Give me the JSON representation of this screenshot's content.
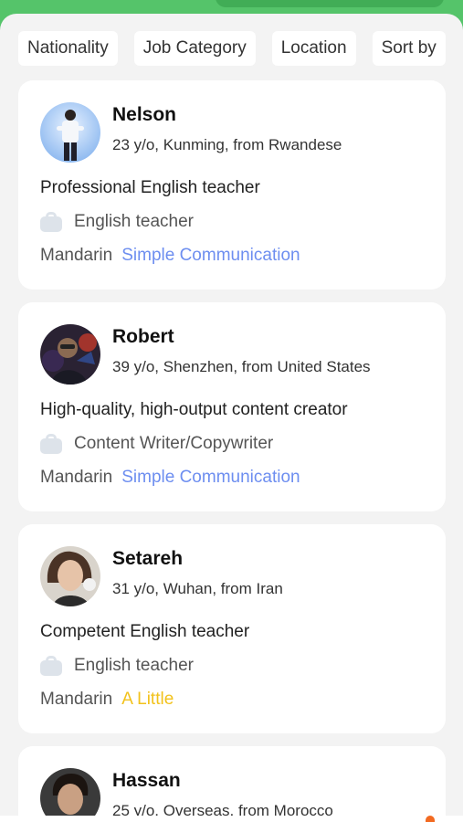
{
  "filters": [
    "Nationality",
    "Job Category",
    "Location",
    "Sort by"
  ],
  "candidates": [
    {
      "name": "Nelson",
      "meta": "23 y/o, Kunming, from Rwandese",
      "headline": "Professional English teacher",
      "job": "English teacher",
      "language": "Mandarin",
      "level": "Simple Communication",
      "level_color": "#6d8ef0"
    },
    {
      "name": "Robert",
      "meta": "39 y/o, Shenzhen, from United States",
      "headline": "High-quality, high-output content creator",
      "job": "Content Writer/Copywriter",
      "language": "Mandarin",
      "level": "Simple Communication",
      "level_color": "#6d8ef0"
    },
    {
      "name": "Setareh",
      "meta": "31 y/o, Wuhan, from Iran",
      "headline": "Competent English teacher",
      "job": "English teacher",
      "language": "Mandarin",
      "level": "A Little",
      "level_color": "#f2c21b"
    },
    {
      "name": "Hassan",
      "meta": "25 y/o, Overseas, from Morocco"
    }
  ],
  "colors": {
    "brand_green": "#55c46a",
    "background": "#f3f3f3",
    "accent_orange": "#f26a21"
  },
  "icons": {
    "job": "briefcase-icon"
  }
}
